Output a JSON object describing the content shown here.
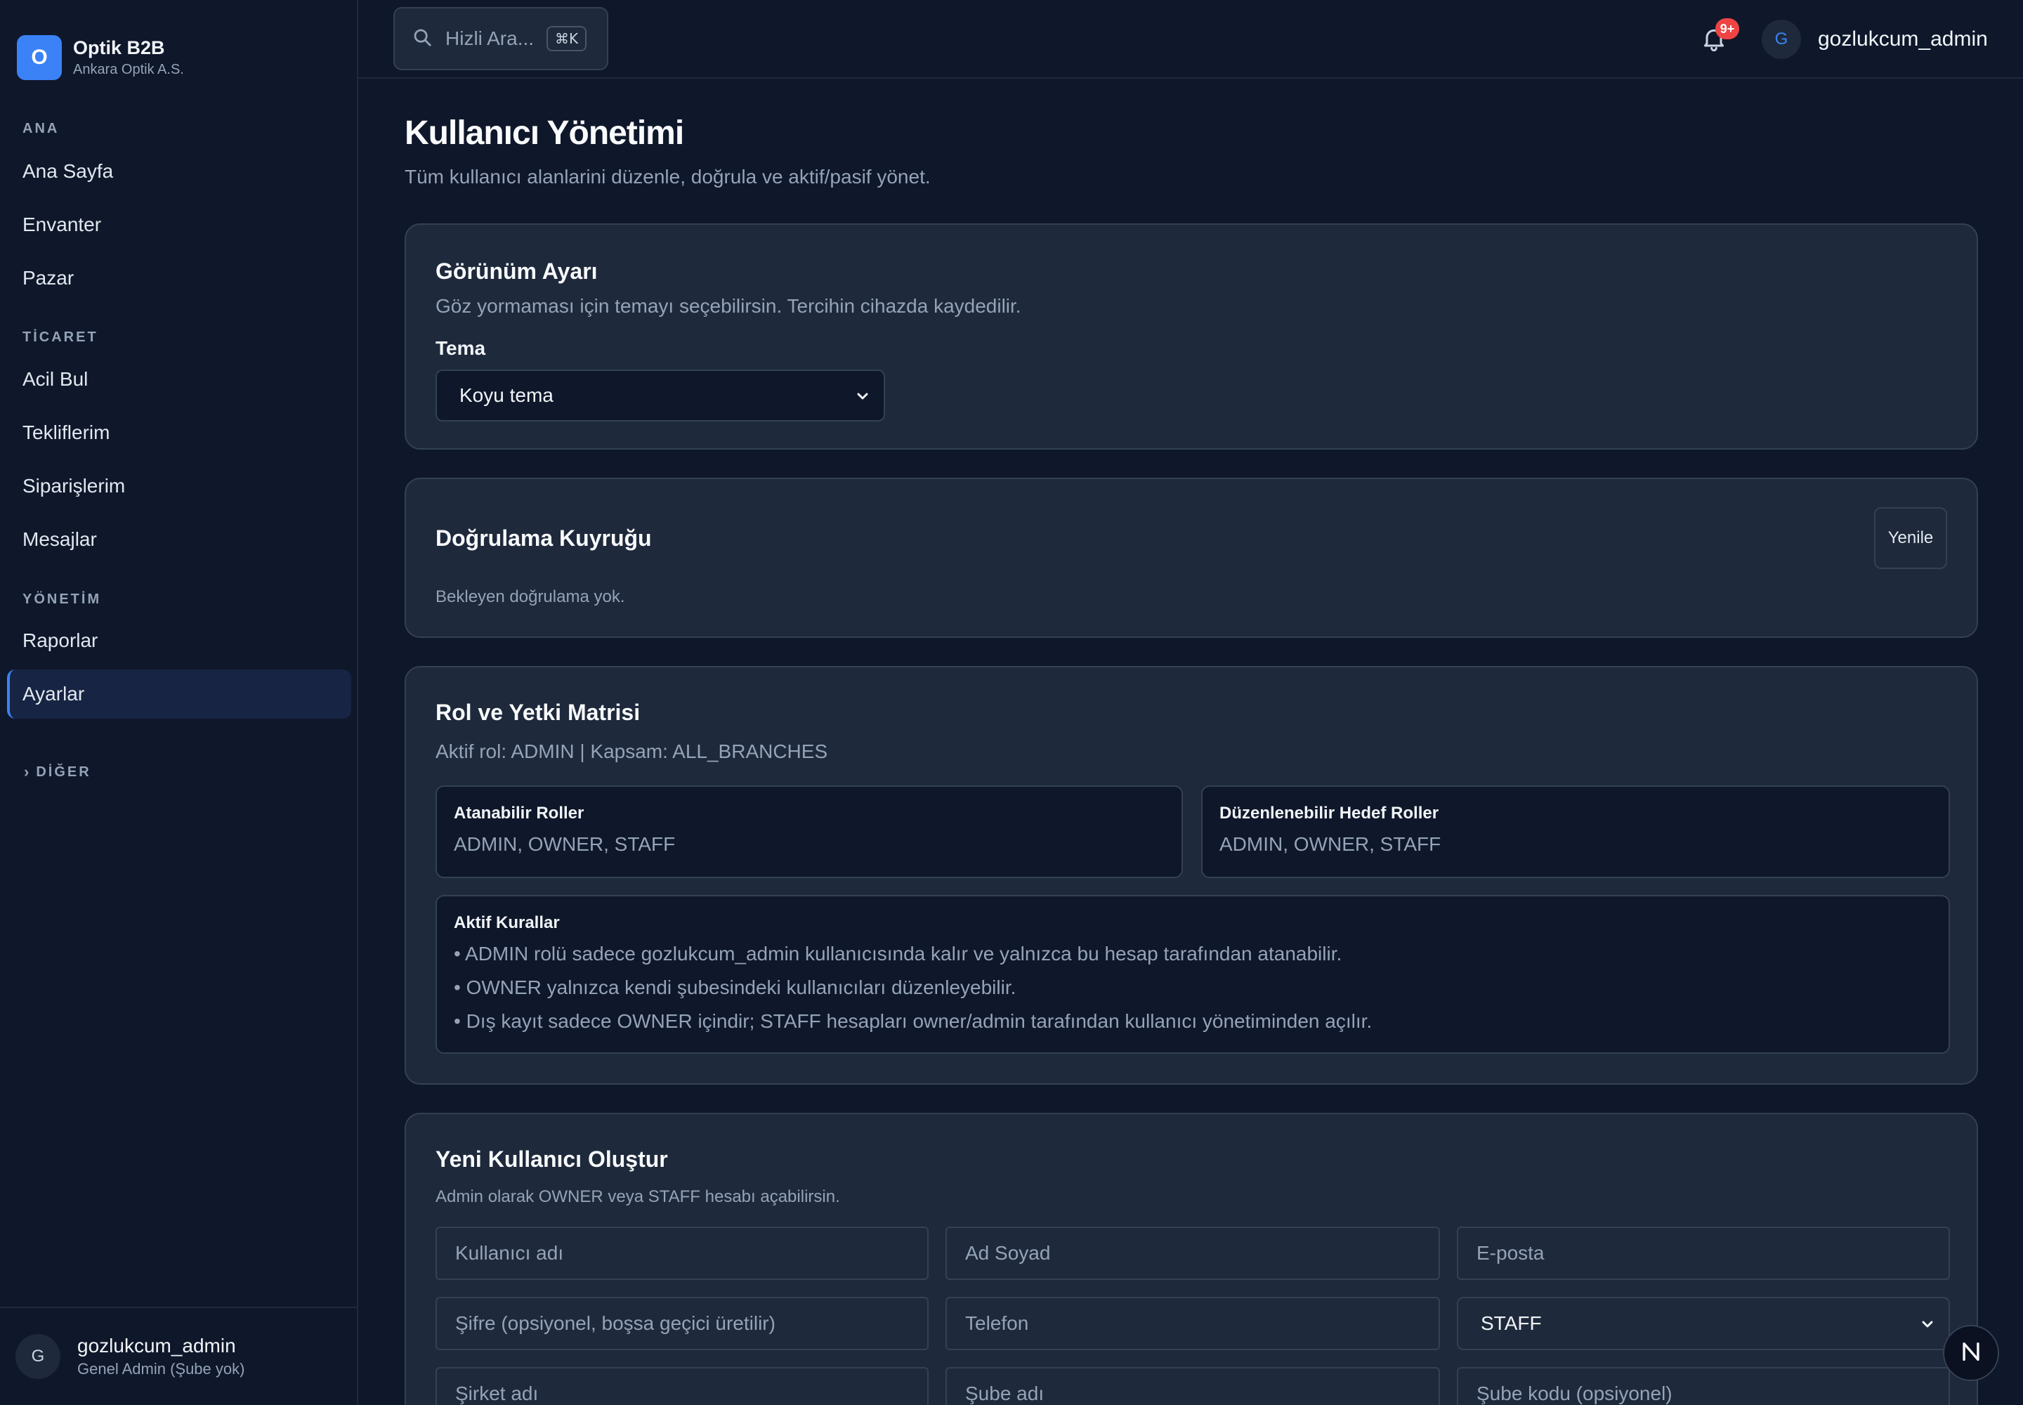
{
  "brand": {
    "logo_letter": "O",
    "name": "Optik B2B",
    "company": "Ankara Optik A.S."
  },
  "sidebar": {
    "sections": [
      {
        "title": "ANA",
        "items": [
          "Ana Sayfa",
          "Envanter",
          "Pazar"
        ]
      },
      {
        "title": "TİCARET",
        "items": [
          "Acil Bul",
          "Tekliflerim",
          "Siparişlerim",
          "Mesajlar"
        ]
      },
      {
        "title": "YÖNETİM",
        "items": [
          "Raporlar",
          "Ayarlar"
        ]
      }
    ],
    "active_item": "Ayarlar",
    "more_label": "DİĞER",
    "footer": {
      "avatar_letter": "G",
      "username": "gozlukcum_admin",
      "role": "Genel Admin (Şube yok)"
    }
  },
  "topbar": {
    "search_placeholder": "Hizli Ara...",
    "search_shortcut": "⌘K",
    "notification_badge": "9+",
    "user_avatar_letter": "G",
    "username": "gozlukcum_admin"
  },
  "page": {
    "title": "Kullanıcı Yönetimi",
    "subtitle": "Tüm kullanıcı alanlarini düzenle, doğrula ve aktif/pasif yönet."
  },
  "appearance": {
    "title": "Görünüm Ayarı",
    "description": "Göz yormaması için temayı seçebilirsin. Tercihin cihazda kaydedilir.",
    "theme_label": "Tema",
    "theme_value": "Koyu tema"
  },
  "verification": {
    "title": "Doğrulama Kuyruğu",
    "refresh_label": "Yenile",
    "empty_text": "Bekleyen doğrulama yok."
  },
  "roles": {
    "title": "Rol ve Yetki Matrisi",
    "active_role_text": "Aktif rol: ADMIN | Kapsam: ALL_BRANCHES",
    "assignable_title": "Atanabilir Roller",
    "assignable_value": "ADMIN, OWNER, STAFF",
    "editable_title": "Düzenlenebilir Hedef Roller",
    "editable_value": "ADMIN, OWNER, STAFF",
    "rules_title": "Aktif Kurallar",
    "rules": [
      "• ADMIN rolü sadece gozlukcum_admin kullanıcısında kalır ve yalnızca bu hesap tarafından atanabilir.",
      "• OWNER yalnızca kendi şubesindeki kullanıcıları düzenleyebilir.",
      "• Dış kayıt sadece OWNER içindir; STAFF hesapları owner/admin tarafından kullanıcı yönetiminden açılır."
    ]
  },
  "new_user": {
    "title": "Yeni Kullanıcı Oluştur",
    "description": "Admin olarak OWNER veya STAFF hesabı açabilirsin.",
    "placeholders": {
      "username": "Kullanıcı adı",
      "full_name": "Ad Soyad",
      "email": "E-posta",
      "password": "Şifre (opsiyonel, boşsa geçici üretilir)",
      "phone": "Telefon",
      "company": "Şirket adı",
      "branch": "Şube adı",
      "branch_code": "Şube kodu (opsiyonel)"
    },
    "role_value": "STAFF"
  },
  "fab_label": "N",
  "colors": {
    "accent": "#3b82f6",
    "background": "#0f172a",
    "card": "#1e293b",
    "badge": "#ef4444"
  }
}
